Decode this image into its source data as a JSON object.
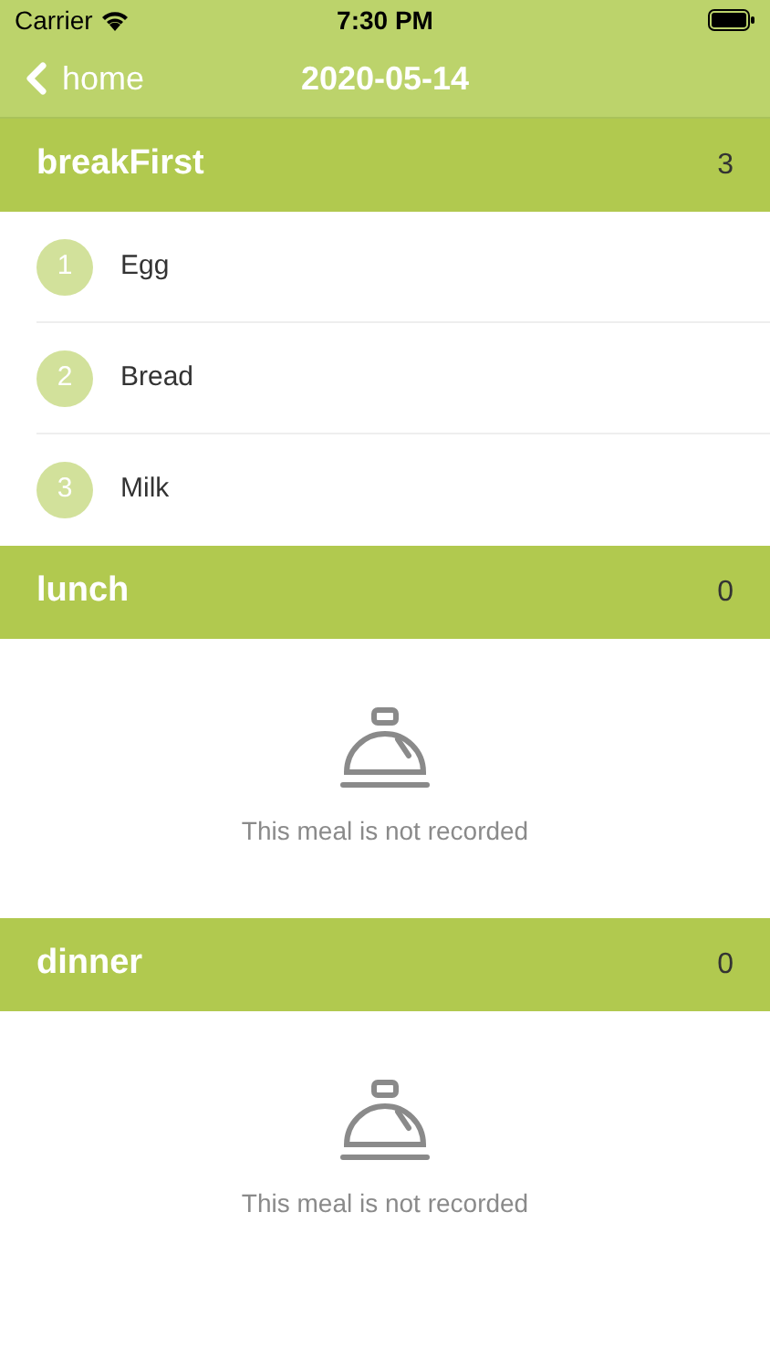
{
  "status_bar": {
    "carrier": "Carrier",
    "time": "7:30 PM"
  },
  "nav": {
    "back": "home",
    "title": "2020-05-14"
  },
  "meals": [
    {
      "name": "breakFirst",
      "count": "3",
      "items": [
        {
          "number": "1",
          "name": "Egg"
        },
        {
          "number": "2",
          "name": "Bread"
        },
        {
          "number": "3",
          "name": "Milk"
        }
      ]
    },
    {
      "name": "lunch",
      "count": "0",
      "empty_message": "This meal is not recorded"
    },
    {
      "name": "dinner",
      "count": "0",
      "empty_message": "This meal is not recorded"
    }
  ]
}
